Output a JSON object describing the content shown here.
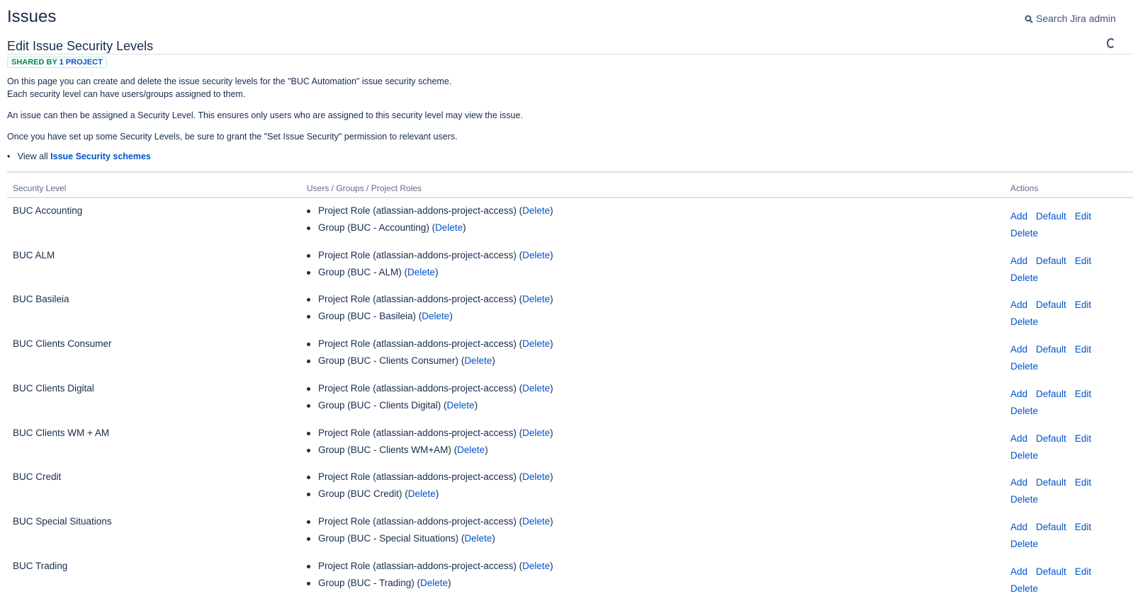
{
  "header": {
    "title": "Issues",
    "search_label": "Search Jira admin"
  },
  "page": {
    "heading": "Edit Issue Security Levels",
    "badge_prefix": "SHARED BY",
    "badge_count": "1 PROJECT",
    "p1a": "On this page you can create and delete the issue security levels for the \"BUC Automation\" issue security scheme.",
    "p1b": "Each security level can have users/groups assigned to them.",
    "p2": "An issue can then be assigned a Security Level. This ensures only users who are assigned to this security level may view the issue.",
    "p3": "Once you have set up some Security Levels, be sure to grant the \"Set Issue Security\" permission to relevant users.",
    "view_all": "View all",
    "schemes_link": "Issue Security schemes"
  },
  "table": {
    "headers": [
      "Security Level",
      "Users / Groups / Project Roles",
      "Actions"
    ],
    "actions": {
      "add": "Add",
      "default": "Default",
      "edit": "Edit",
      "delete": "Delete"
    },
    "delete_link": "Delete",
    "rows": [
      {
        "level": "BUC Accounting",
        "entries": [
          "Project Role (atlassian-addons-project-access)",
          "Group (BUC - Accounting)"
        ]
      },
      {
        "level": "BUC ALM",
        "entries": [
          "Project Role (atlassian-addons-project-access)",
          "Group (BUC - ALM)"
        ]
      },
      {
        "level": "BUC Basileia",
        "entries": [
          "Project Role (atlassian-addons-project-access)",
          "Group (BUC - Basileia)"
        ]
      },
      {
        "level": "BUC Clients Consumer",
        "entries": [
          "Project Role (atlassian-addons-project-access)",
          "Group (BUC - Clients Consumer)"
        ]
      },
      {
        "level": "BUC Clients Digital",
        "entries": [
          "Project Role (atlassian-addons-project-access)",
          "Group (BUC - Clients Digital)"
        ]
      },
      {
        "level": "BUC Clients WM + AM",
        "entries": [
          "Project Role (atlassian-addons-project-access)",
          "Group (BUC - Clients WM+AM)"
        ]
      },
      {
        "level": "BUC Credit",
        "entries": [
          "Project Role (atlassian-addons-project-access)",
          "Group (BUC Credit)"
        ]
      },
      {
        "level": "BUC Special Situations",
        "entries": [
          "Project Role (atlassian-addons-project-access)",
          "Group (BUC - Special Situations)"
        ]
      },
      {
        "level": "BUC Trading",
        "entries": [
          "Project Role (atlassian-addons-project-access)",
          "Group (BUC - Trading)"
        ]
      }
    ]
  }
}
